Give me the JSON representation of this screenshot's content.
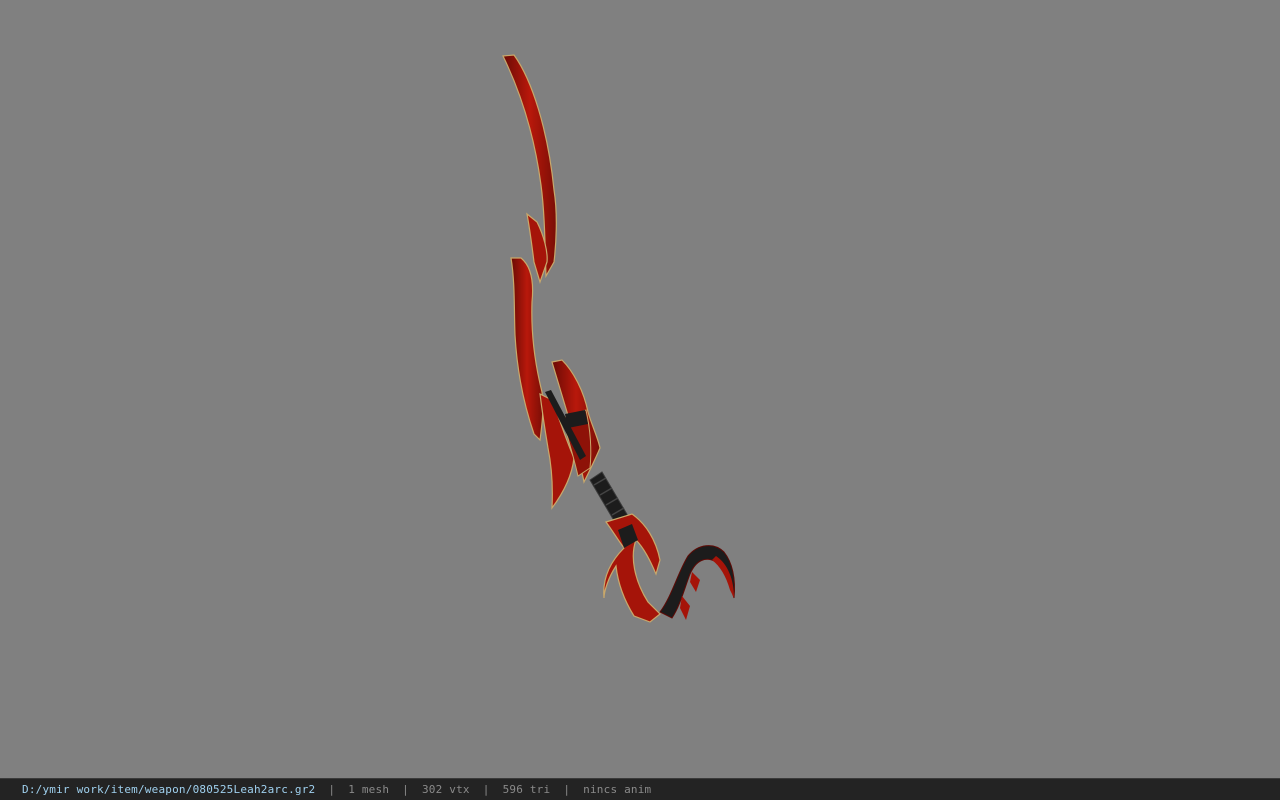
{
  "viewer": {
    "background_color": "#808080",
    "model": {
      "name": "red-crescent-sword",
      "colors": {
        "blade": "#a51409",
        "blade_dark": "#5e0a05",
        "trim": "#c9a86a",
        "handle": "#1c1c1c",
        "handle_band": "#3a3a3a"
      }
    }
  },
  "status_bar": {
    "file_path": "D:/ymir work/item/weapon/080525Leah2arc.gr2",
    "separator": "|",
    "mesh": "1 mesh",
    "vtx": "302 vtx",
    "tri": "596 tri",
    "anim": "nincs anim",
    "text_color": "#9fd0ee",
    "muted_color": "#8a8a8a",
    "background": "#232323"
  }
}
